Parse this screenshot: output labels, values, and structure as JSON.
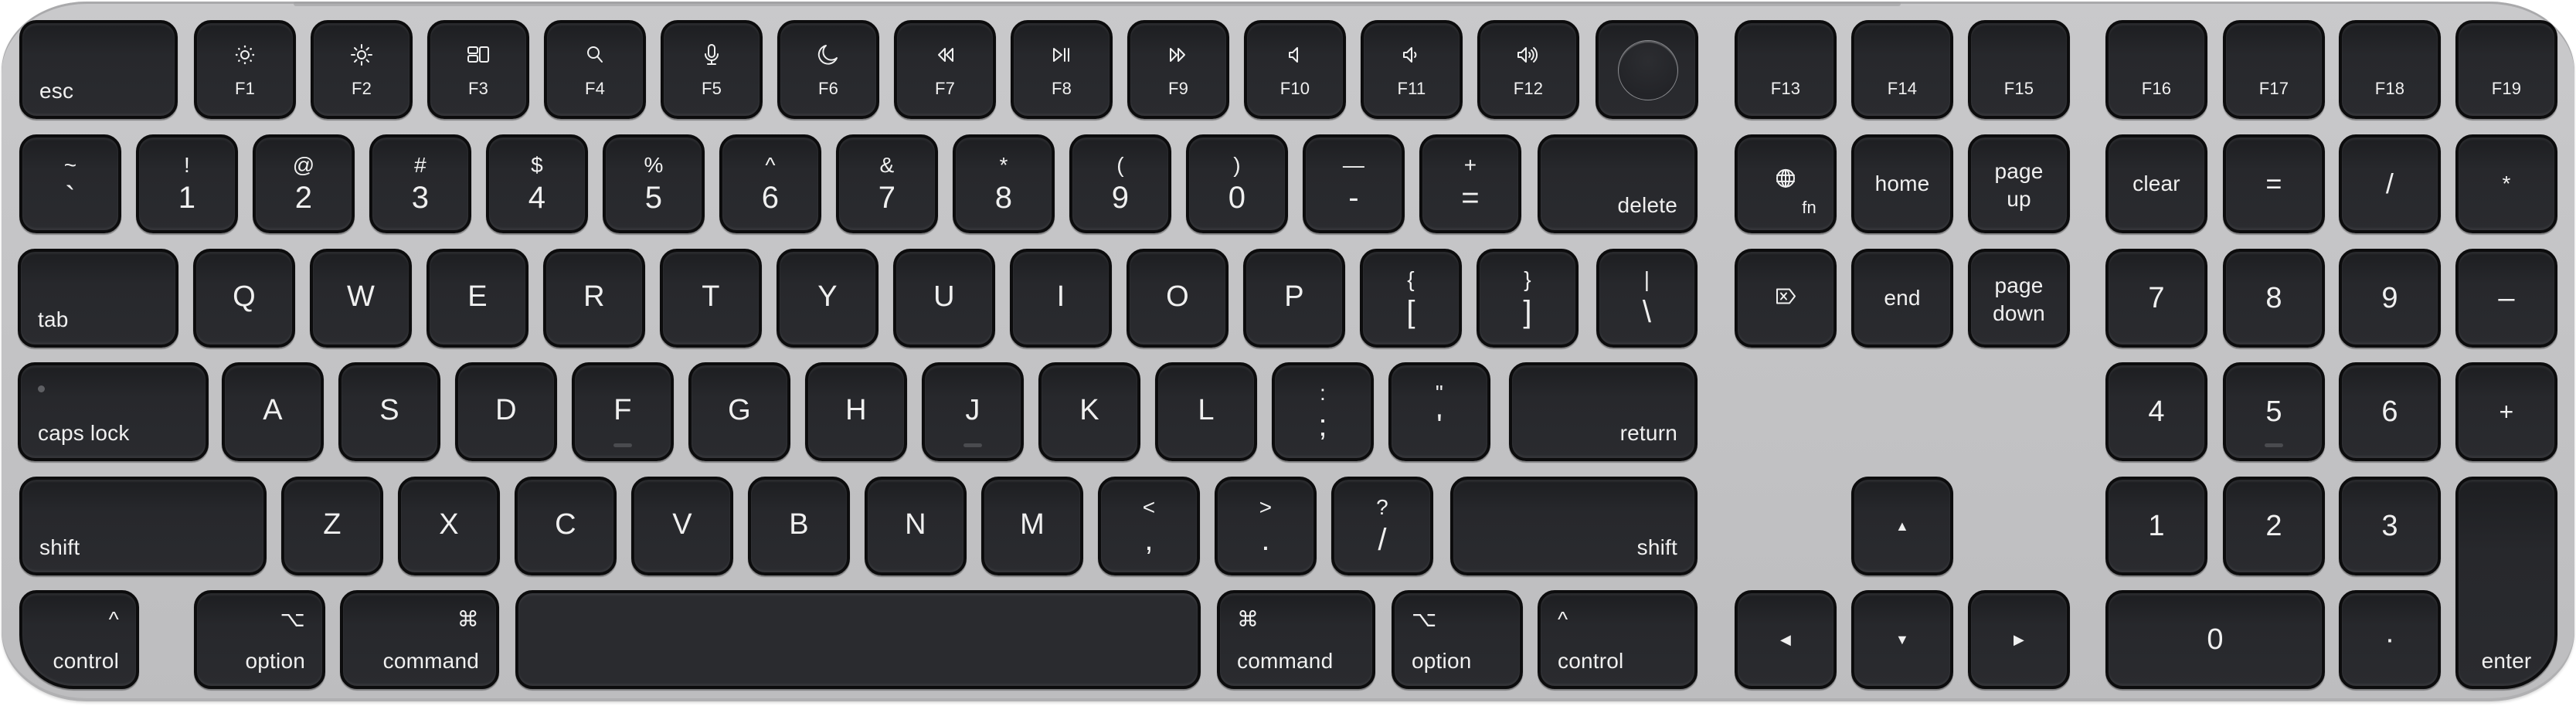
{
  "device": "Magic Keyboard with Touch ID and Numeric Keypad",
  "colors": {
    "body": "#c5c5c7",
    "key": "#28292d",
    "legend": "#f0f0f0"
  },
  "function_row": {
    "esc": "esc",
    "keys": [
      {
        "label": "F1",
        "icon": "brightness-down-icon"
      },
      {
        "label": "F2",
        "icon": "brightness-up-icon"
      },
      {
        "label": "F3",
        "icon": "mission-control-icon"
      },
      {
        "label": "F4",
        "icon": "search-icon"
      },
      {
        "label": "F5",
        "icon": "microphone-icon"
      },
      {
        "label": "F6",
        "icon": "do-not-disturb-moon-icon"
      },
      {
        "label": "F7",
        "icon": "rewind-icon"
      },
      {
        "label": "F8",
        "icon": "play-pause-icon"
      },
      {
        "label": "F9",
        "icon": "fast-forward-icon"
      },
      {
        "label": "F10",
        "icon": "mute-icon"
      },
      {
        "label": "F11",
        "icon": "volume-down-icon"
      },
      {
        "label": "F12",
        "icon": "volume-up-icon"
      }
    ],
    "touch_id": "touch-id-sensor",
    "extended": [
      "F13",
      "F14",
      "F15",
      "F16",
      "F17",
      "F18",
      "F19"
    ]
  },
  "number_row": {
    "keys": [
      {
        "top": "~",
        "bottom": "`"
      },
      {
        "top": "!",
        "bottom": "1"
      },
      {
        "top": "@",
        "bottom": "2"
      },
      {
        "top": "#",
        "bottom": "3"
      },
      {
        "top": "$",
        "bottom": "4"
      },
      {
        "top": "%",
        "bottom": "5"
      },
      {
        "top": "^",
        "bottom": "6"
      },
      {
        "top": "&",
        "bottom": "7"
      },
      {
        "top": "*",
        "bottom": "8"
      },
      {
        "top": "(",
        "bottom": "9"
      },
      {
        "top": ")",
        "bottom": "0"
      },
      {
        "top": "—",
        "bottom": "-"
      },
      {
        "top": "+",
        "bottom": "="
      }
    ],
    "delete": "delete"
  },
  "qwerty_row": {
    "tab": "tab",
    "letters": [
      "Q",
      "W",
      "E",
      "R",
      "T",
      "Y",
      "U",
      "I",
      "O",
      "P"
    ],
    "brackets": [
      {
        "top": "{",
        "bottom": "["
      },
      {
        "top": "}",
        "bottom": "]"
      }
    ],
    "backslash": {
      "top": "|",
      "bottom": "\\"
    }
  },
  "home_row": {
    "caps_lock": "caps lock",
    "letters": [
      "A",
      "S",
      "D",
      "F",
      "G",
      "H",
      "J",
      "K",
      "L"
    ],
    "punct": [
      {
        "top": ":",
        "bottom": ";"
      },
      {
        "top": "\"",
        "bottom": "'"
      }
    ],
    "return": "return"
  },
  "bottom_letter_row": {
    "shift_left": "shift",
    "letters": [
      "Z",
      "X",
      "C",
      "V",
      "B",
      "N",
      "M"
    ],
    "punct": [
      {
        "top": "<",
        "bottom": ","
      },
      {
        "top": ">",
        "bottom": "."
      },
      {
        "top": "?",
        "bottom": "/"
      }
    ],
    "shift_right": "shift"
  },
  "modifier_row": {
    "control_left": {
      "symbol": "^",
      "label": "control"
    },
    "option_left": {
      "symbol": "⌥",
      "label": "option"
    },
    "command_left": {
      "symbol": "⌘",
      "label": "command"
    },
    "command_right": {
      "symbol": "⌘",
      "label": "command"
    },
    "option_right": {
      "symbol": "⌥",
      "label": "option"
    },
    "control_right": {
      "symbol": "^",
      "label": "control"
    }
  },
  "nav_cluster": {
    "fn": {
      "icon": "globe-icon",
      "label": "fn"
    },
    "home": "home",
    "page_up": [
      "page",
      "up"
    ],
    "forward_delete": "forward-delete-icon",
    "end": "end",
    "page_down": [
      "page",
      "down"
    ],
    "arrows": {
      "up": "▲",
      "left": "◀",
      "down": "▼",
      "right": "▶"
    }
  },
  "numpad": {
    "row1": [
      "clear",
      "=",
      "/",
      "*"
    ],
    "row2": [
      "7",
      "8",
      "9",
      "–"
    ],
    "row3": [
      "4",
      "5",
      "6",
      "+"
    ],
    "row4": [
      "1",
      "2",
      "3"
    ],
    "zero": "0",
    "decimal": "·",
    "enter": "enter"
  }
}
